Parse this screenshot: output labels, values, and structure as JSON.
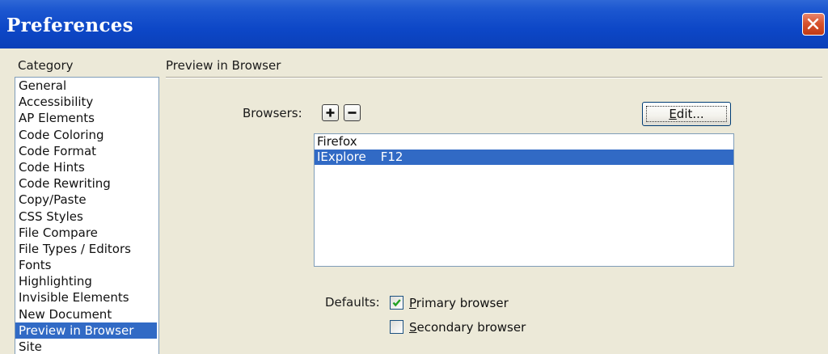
{
  "window": {
    "title": "Preferences"
  },
  "category": {
    "label": "Category",
    "items": [
      "General",
      "Accessibility",
      "AP Elements",
      "Code Coloring",
      "Code Format",
      "Code Hints",
      "Code Rewriting",
      "Copy/Paste",
      "CSS Styles",
      "File Compare",
      "File Types / Editors",
      "Fonts",
      "Highlighting",
      "Invisible Elements",
      "New Document",
      "Preview in Browser",
      "Site"
    ],
    "selected": "Preview in Browser"
  },
  "panel": {
    "title": "Preview in Browser",
    "browsers_label": "Browsers:",
    "add_icon": "plus-icon",
    "remove_icon": "minus-icon",
    "edit_label_accel": "E",
    "edit_label_rest": "dit...",
    "browsers": [
      {
        "name": "Firefox",
        "key": ""
      },
      {
        "name": "IExplore",
        "key": "F12"
      }
    ],
    "selected_browser": "IExplore",
    "defaults_label": "Defaults:",
    "primary": {
      "accel": "P",
      "rest": "rimary browser",
      "checked": true
    },
    "secondary": {
      "accel": "S",
      "rest": "econdary browser",
      "checked": false
    }
  },
  "colors": {
    "selection": "#316ac5",
    "titlebar": "#0d47c7",
    "checkmark": "#21a121"
  }
}
